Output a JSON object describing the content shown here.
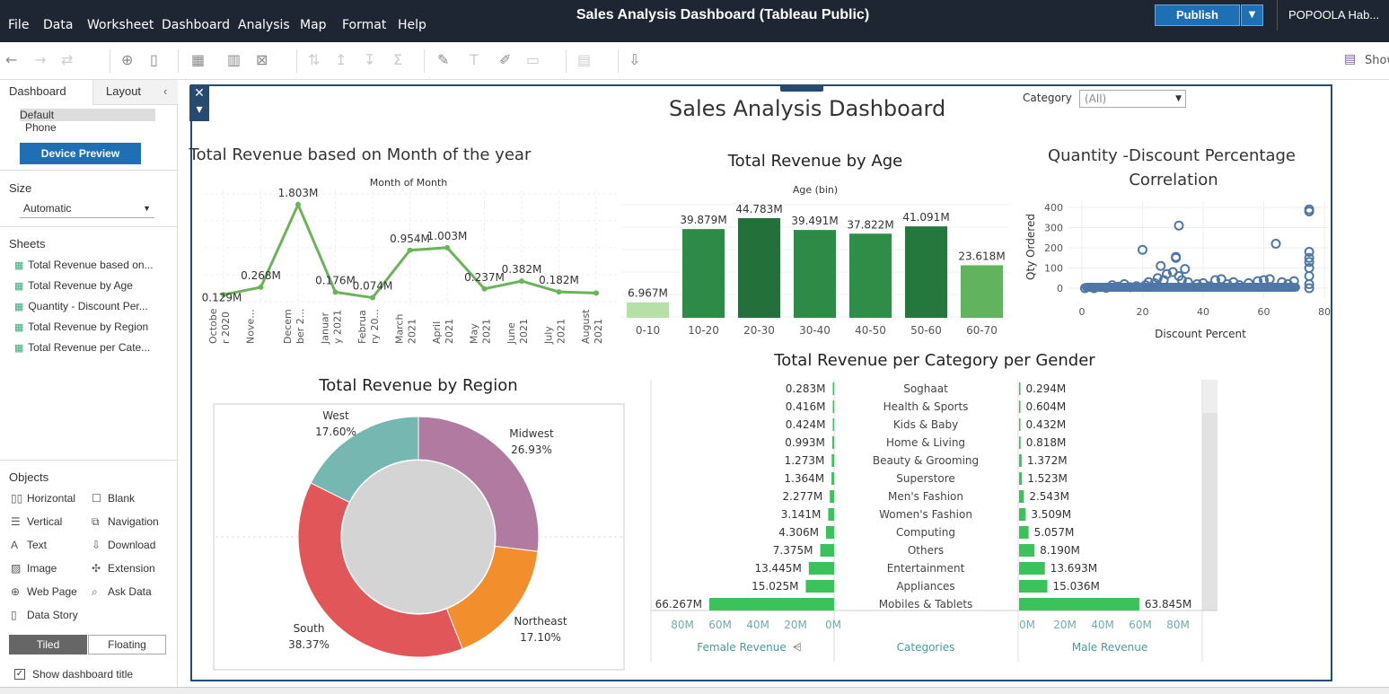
{
  "menubar": {
    "items": [
      "File",
      "Data",
      "Worksheet",
      "Dashboard",
      "Analysis",
      "Map",
      "Format",
      "Help"
    ],
    "title": "Sales Analysis Dashboard (Tableau Public)",
    "publish": "Publish",
    "user": "POPOOLA Hab..."
  },
  "toolbar": {
    "show_label": "Show"
  },
  "left_panel": {
    "tabs": [
      "Dashboard",
      "Layout"
    ],
    "device_options": [
      "Default",
      "Phone"
    ],
    "device_preview": "Device Preview",
    "size_label": "Size",
    "size_value": "Automatic",
    "sheets_label": "Sheets",
    "sheets": [
      "Total Revenue based on...",
      "Total Revenue by Age",
      "Quantity - Discount Per...",
      "Total Revenue by Region",
      "Total Revenue per Cate..."
    ],
    "objects_label": "Objects",
    "objects": [
      "Horizontal",
      "Blank",
      "Vertical",
      "Navigation",
      "Text",
      "Download",
      "Image",
      "Extension",
      "Web Page",
      "Ask Data",
      "Data Story"
    ],
    "tiled": "Tiled",
    "floating": "Floating",
    "show_title": "Show dashboard title"
  },
  "dashboard": {
    "title": "Sales Analysis Dashboard",
    "filter_label": "Category",
    "filter_value": "(All)"
  },
  "chart_data": [
    {
      "type": "line",
      "title": "Total Revenue based on Month of the year",
      "header": "Month of Month",
      "categories": [
        "October 2020",
        "November 2020",
        "December 2020",
        "January 2021",
        "February 2021",
        "March 2021",
        "April 2021",
        "May 2021",
        "June 2021",
        "July 2021",
        "August 2021"
      ],
      "tick_labels": [
        "Octobe r 2020",
        "Nove...",
        "Decem ber 2...",
        "Januar y 2021",
        "Februa ry 20...",
        "March 2021",
        "April 2021",
        "May 2021",
        "June 2021",
        "July 2021",
        "August 2021"
      ],
      "values": [
        0.129,
        0.268,
        1.803,
        0.176,
        0.074,
        0.954,
        1.003,
        0.237,
        0.382,
        0.182,
        0.16
      ],
      "data_labels": [
        "0.129M",
        "0.268M",
        "1.803M",
        "0.176M",
        "0.074M",
        "0.954M",
        "1.003M",
        "0.237M",
        "0.382M",
        "0.182M",
        ""
      ],
      "color": "#6bb35a"
    },
    {
      "type": "bar",
      "title": "Total Revenue by Age",
      "header": "Age (bin)",
      "categories": [
        "0-10",
        "10-20",
        "20-30",
        "30-40",
        "40-50",
        "50-60",
        "60-70"
      ],
      "values": [
        6.967,
        39.879,
        44.783,
        39.491,
        37.822,
        41.091,
        23.618
      ],
      "data_labels": [
        "6.967M",
        "39.879M",
        "44.783M",
        "39.491M",
        "37.822M",
        "41.091M",
        "23.618M"
      ],
      "colors": [
        "#b5e0a6",
        "#2e8a47",
        "#23703a",
        "#2e8a47",
        "#2f8d48",
        "#25773d",
        "#62b35d"
      ]
    },
    {
      "type": "scatter",
      "title": "Quantity -Discount Percentage Correlation",
      "xlabel": "Discount Percent",
      "ylabel": "Qty Ordered",
      "x_ticks": [
        0,
        20,
        40,
        60,
        80
      ],
      "y_ticks": [
        0,
        100,
        200,
        300,
        400
      ],
      "xlim": [
        0,
        80
      ],
      "ylim": [
        0,
        400
      ],
      "points": [
        [
          1,
          0
        ],
        [
          4,
          0
        ],
        [
          8,
          2
        ],
        [
          10,
          15
        ],
        [
          12,
          8
        ],
        [
          14,
          20
        ],
        [
          16,
          5
        ],
        [
          18,
          10
        ],
        [
          20,
          190
        ],
        [
          21,
          15
        ],
        [
          22,
          30
        ],
        [
          24,
          25
        ],
        [
          25,
          50
        ],
        [
          26,
          110
        ],
        [
          27,
          40
        ],
        [
          28,
          70
        ],
        [
          30,
          80
        ],
        [
          31,
          150
        ],
        [
          31,
          155
        ],
        [
          32,
          310
        ],
        [
          32,
          60
        ],
        [
          33,
          40
        ],
        [
          34,
          95
        ],
        [
          35,
          30
        ],
        [
          38,
          20
        ],
        [
          40,
          25
        ],
        [
          42,
          10
        ],
        [
          44,
          40
        ],
        [
          46,
          45
        ],
        [
          48,
          20
        ],
        [
          50,
          30
        ],
        [
          52,
          15
        ],
        [
          55,
          25
        ],
        [
          58,
          35
        ],
        [
          60,
          40
        ],
        [
          62,
          45
        ],
        [
          64,
          220
        ],
        [
          66,
          30
        ],
        [
          68,
          20
        ],
        [
          70,
          35
        ],
        [
          75,
          0
        ],
        [
          75,
          20
        ],
        [
          75,
          60
        ],
        [
          75,
          100
        ],
        [
          75,
          130
        ],
        [
          75,
          150
        ],
        [
          75,
          180
        ],
        [
          75,
          380
        ],
        [
          75,
          390
        ]
      ],
      "color": "#4f76a6"
    },
    {
      "type": "pie",
      "title": "Total Revenue by Region",
      "slices": [
        {
          "label": "Midwest",
          "value": 26.93,
          "pct": "26.93%",
          "color": "#b07aa1"
        },
        {
          "label": "Northeast",
          "value": 17.1,
          "pct": "17.10%",
          "color": "#f28e2b"
        },
        {
          "label": "South",
          "value": 38.37,
          "pct": "38.37%",
          "color": "#e15759"
        },
        {
          "label": "West",
          "value": 17.6,
          "pct": "17.60%",
          "color": "#76b7b2"
        }
      ]
    },
    {
      "type": "bar",
      "title": "Total Revenue per Category per Gender",
      "categories": [
        "Soghaat",
        "Health & Sports",
        "Kids & Baby",
        "Home & Living",
        "Beauty & Grooming",
        "Superstore",
        "Men's Fashion",
        "Women's Fashion",
        "Computing",
        "Others",
        "Entertainment",
        "Appliances",
        "Mobiles & Tablets"
      ],
      "series": [
        {
          "name": "Female Revenue",
          "values": [
            0.283,
            0.416,
            0.424,
            0.993,
            1.273,
            1.364,
            2.277,
            3.141,
            4.306,
            7.375,
            13.445,
            15.025,
            66.267
          ],
          "labels": [
            "0.283M",
            "0.416M",
            "0.424M",
            "0.993M",
            "1.273M",
            "1.364M",
            "2.277M",
            "3.141M",
            "4.306M",
            "7.375M",
            "13.445M",
            "15.025M",
            "66.267M"
          ]
        },
        {
          "name": "Male Revenue",
          "values": [
            0.294,
            0.604,
            0.432,
            0.818,
            1.372,
            1.523,
            2.543,
            3.509,
            5.057,
            8.19,
            13.693,
            15.036,
            63.845
          ],
          "labels": [
            "0.294M",
            "0.604M",
            "0.432M",
            "0.818M",
            "1.372M",
            "1.523M",
            "2.543M",
            "3.509M",
            "5.057M",
            "8.190M",
            "13.693M",
            "15.036M",
            "63.845M"
          ]
        }
      ],
      "female_axis": [
        "80M",
        "60M",
        "40M",
        "20M",
        "0M"
      ],
      "male_axis": [
        "0M",
        "20M",
        "40M",
        "60M",
        "80M"
      ],
      "middle_header": "Categories",
      "xlim": [
        0,
        80
      ],
      "color": "#3cc25a"
    }
  ]
}
